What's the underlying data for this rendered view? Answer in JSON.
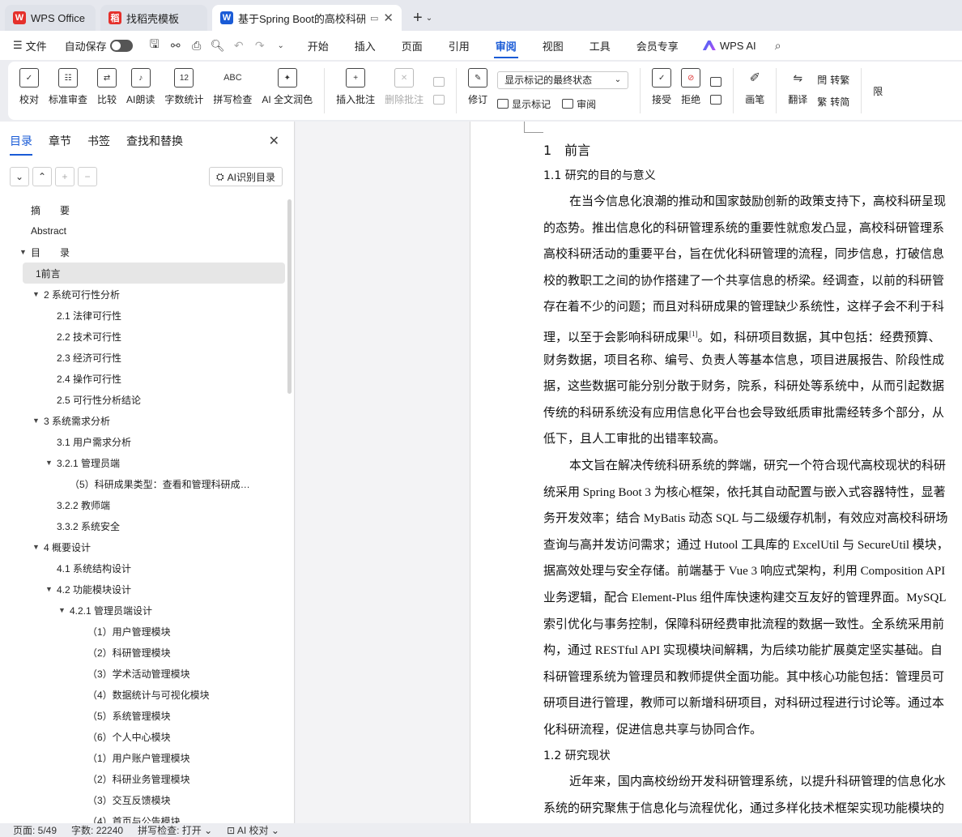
{
  "titlebar": {
    "tabs": [
      {
        "label": "WPS Office",
        "icon": "wps-logo-icon",
        "color": "#e5302b"
      },
      {
        "label": "找稻壳模板",
        "icon": "docer-icon",
        "color": "#e5302b"
      },
      {
        "label": "基于Spring Boot的高校科研",
        "icon": "writer-icon",
        "color": "#1a5bd6"
      }
    ],
    "new_tab": "+"
  },
  "menubar": {
    "file": "文件",
    "autosave": "自动保存",
    "tabs": [
      "开始",
      "插入",
      "页面",
      "引用",
      "审阅",
      "视图",
      "工具",
      "会员专享"
    ],
    "active_tab": "审阅",
    "wps_ai": "WPS AI"
  },
  "ribbon": {
    "proofread": "校对",
    "standard_review": "标准审查",
    "compare": "比较",
    "ai_read": "AI朗读",
    "word_count": "字数统计",
    "spell_check": "拼写检查",
    "ai_polish": "AI 全文润色",
    "insert_comment": "插入批注",
    "delete_comment": "删除批注",
    "revise": "修订",
    "markup_state": "显示标记的最终状态",
    "show_markup": "显示标记",
    "review": "审阅",
    "accept": "接受",
    "reject": "拒绝",
    "pen": "画笔",
    "translate": "翻译",
    "to_traditional": "转繁",
    "to_simplified": "转简",
    "limit": "限"
  },
  "navpane": {
    "tabs": [
      "目录",
      "章节",
      "书签",
      "查找和替换"
    ],
    "active_tab": "目录",
    "ai_toc": "AI识别目录",
    "toc": [
      {
        "label": "摘　　要",
        "level": 0,
        "arrow": ""
      },
      {
        "label": "Abstract",
        "level": 0,
        "arrow": ""
      },
      {
        "label": "目　　录",
        "level": 0,
        "arrow": "▼"
      },
      {
        "label": "1前言",
        "level": 1,
        "arrow": "",
        "selected": true
      },
      {
        "label": "2  系统可行性分析",
        "level": 1,
        "arrow": "▼"
      },
      {
        "label": "2.1  法律可行性",
        "level": 2,
        "arrow": ""
      },
      {
        "label": "2.2  技术可行性",
        "level": 2,
        "arrow": ""
      },
      {
        "label": "2.3  经济可行性",
        "level": 2,
        "arrow": ""
      },
      {
        "label": "2.4  操作可行性",
        "level": 2,
        "arrow": ""
      },
      {
        "label": "2.5  可行性分析结论",
        "level": 2,
        "arrow": ""
      },
      {
        "label": "3  系统需求分析",
        "level": 1,
        "arrow": "▼"
      },
      {
        "label": "3.1  用户需求分析",
        "level": 2,
        "arrow": ""
      },
      {
        "label": "3.2.1  管理员端",
        "level": 2,
        "arrow": "▼"
      },
      {
        "label": "（5）科研成果类型：查看和管理科研成果类 ...",
        "level": 3,
        "arrow": ""
      },
      {
        "label": "3.2.2  教师端",
        "level": 2,
        "arrow": ""
      },
      {
        "label": "3.3.2  系统安全",
        "level": 2,
        "arrow": ""
      },
      {
        "label": "4  概要设计",
        "level": 1,
        "arrow": "▼"
      },
      {
        "label": "4.1  系统结构设计",
        "level": 2,
        "arrow": ""
      },
      {
        "label": "4.2  功能模块设计",
        "level": 2,
        "arrow": "▼"
      },
      {
        "label": "4.2.1  管理员端设计",
        "level": 3,
        "arrow": "▼"
      },
      {
        "label": "（1）用户管理模块",
        "level": 4,
        "arrow": ""
      },
      {
        "label": "（2）科研管理模块",
        "level": 4,
        "arrow": ""
      },
      {
        "label": "（3）学术活动管理模块",
        "level": 4,
        "arrow": ""
      },
      {
        "label": "（4）数据统计与可视化模块",
        "level": 4,
        "arrow": ""
      },
      {
        "label": "（5）系统管理模块",
        "level": 4,
        "arrow": ""
      },
      {
        "label": "（6）个人中心模块",
        "level": 4,
        "arrow": ""
      },
      {
        "label": "（1）用户账户管理模块",
        "level": 4,
        "arrow": ""
      },
      {
        "label": "（2）科研业务管理模块",
        "level": 4,
        "arrow": ""
      },
      {
        "label": "（3）交互反馈模块",
        "level": 4,
        "arrow": ""
      },
      {
        "label": "（4）首页与公告模块",
        "level": 4,
        "arrow": ""
      }
    ]
  },
  "document": {
    "heading1": "1　前言",
    "heading1_1": "1.1  研究的目的与意义",
    "para1": [
      "在当今信息化浪潮的推动和国家鼓励创新的政策支持下，高校科研呈现",
      "的态势。推出信息化的科研管理系统的重要性就愈发凸显，高校科研管理系",
      "高校科研活动的重要平台，旨在优化科研管理的流程，同步信息，打破信息",
      "校的教职工之间的协作搭建了一个共享信息的桥梁。经调查，以前的科研管",
      "存在着不少的问题；而且对科研成果的管理缺少系统性，这样子会不利于科",
      "理，以至于会影响科研成果",
      "财务数据，项目名称、编号、负责人等基本信息，项目进展报告、阶段性成",
      "据，这些数据可能分别分散于财务，院系，科研处等系统中，从而引起数据",
      "传统的科研系统没有应用信息化平台也会导致纸质审批需经转多个部分，从",
      "低下，且人工审批的出错率较高。"
    ],
    "para1_ref": "[1]",
    "para1_line6_tail": "。如，科研项目数据，其中包括：经费预算、",
    "para2": [
      "本文旨在解决传统科研系统的弊端，研究一个符合现代高校现状的科研",
      "统采用 Spring Boot 3 为核心框架，依托其自动配置与嵌入式容器特性，显著",
      "务开发效率；结合 MyBatis 动态 SQL 与二级缓存机制，有效应对高校科研场",
      "查询与高并发访问需求；通过 Hutool 工具库的 ExcelUtil 与 SecureUtil 模块，",
      "据高效处理与安全存储。前端基于 Vue 3 响应式架构，利用 Composition API",
      "业务逻辑，配合 Element-Plus 组件库快速构建交互友好的管理界面。MySQL",
      "索引优化与事务控制，保障科研经费审批流程的数据一致性。全系统采用前",
      "构，通过 RESTful API 实现模块间解耦，为后续功能扩展奠定坚实基础。自",
      "科研管理系统为管理员和教师提供全面功能。其中核心功能包括：管理员可",
      "研项目进行管理，教师可以新增科研项目，对科研过程进行讨论等。通过本",
      "化科研流程，促进信息共享与协同合作。"
    ],
    "heading1_2": "1.2  研究现状",
    "para3": [
      "近年来，国内高校纷纷开发科研管理系统，以提升科研管理的信息化水",
      "系统的研究聚焦于信息化与流程优化，通过多样化技术框架实现功能模块的"
    ]
  },
  "statusbar": {
    "page": "页面: 5/49",
    "words": "字数: 22240",
    "spell": "拼写检查: 打开",
    "ai_proof": "AI 校对"
  }
}
